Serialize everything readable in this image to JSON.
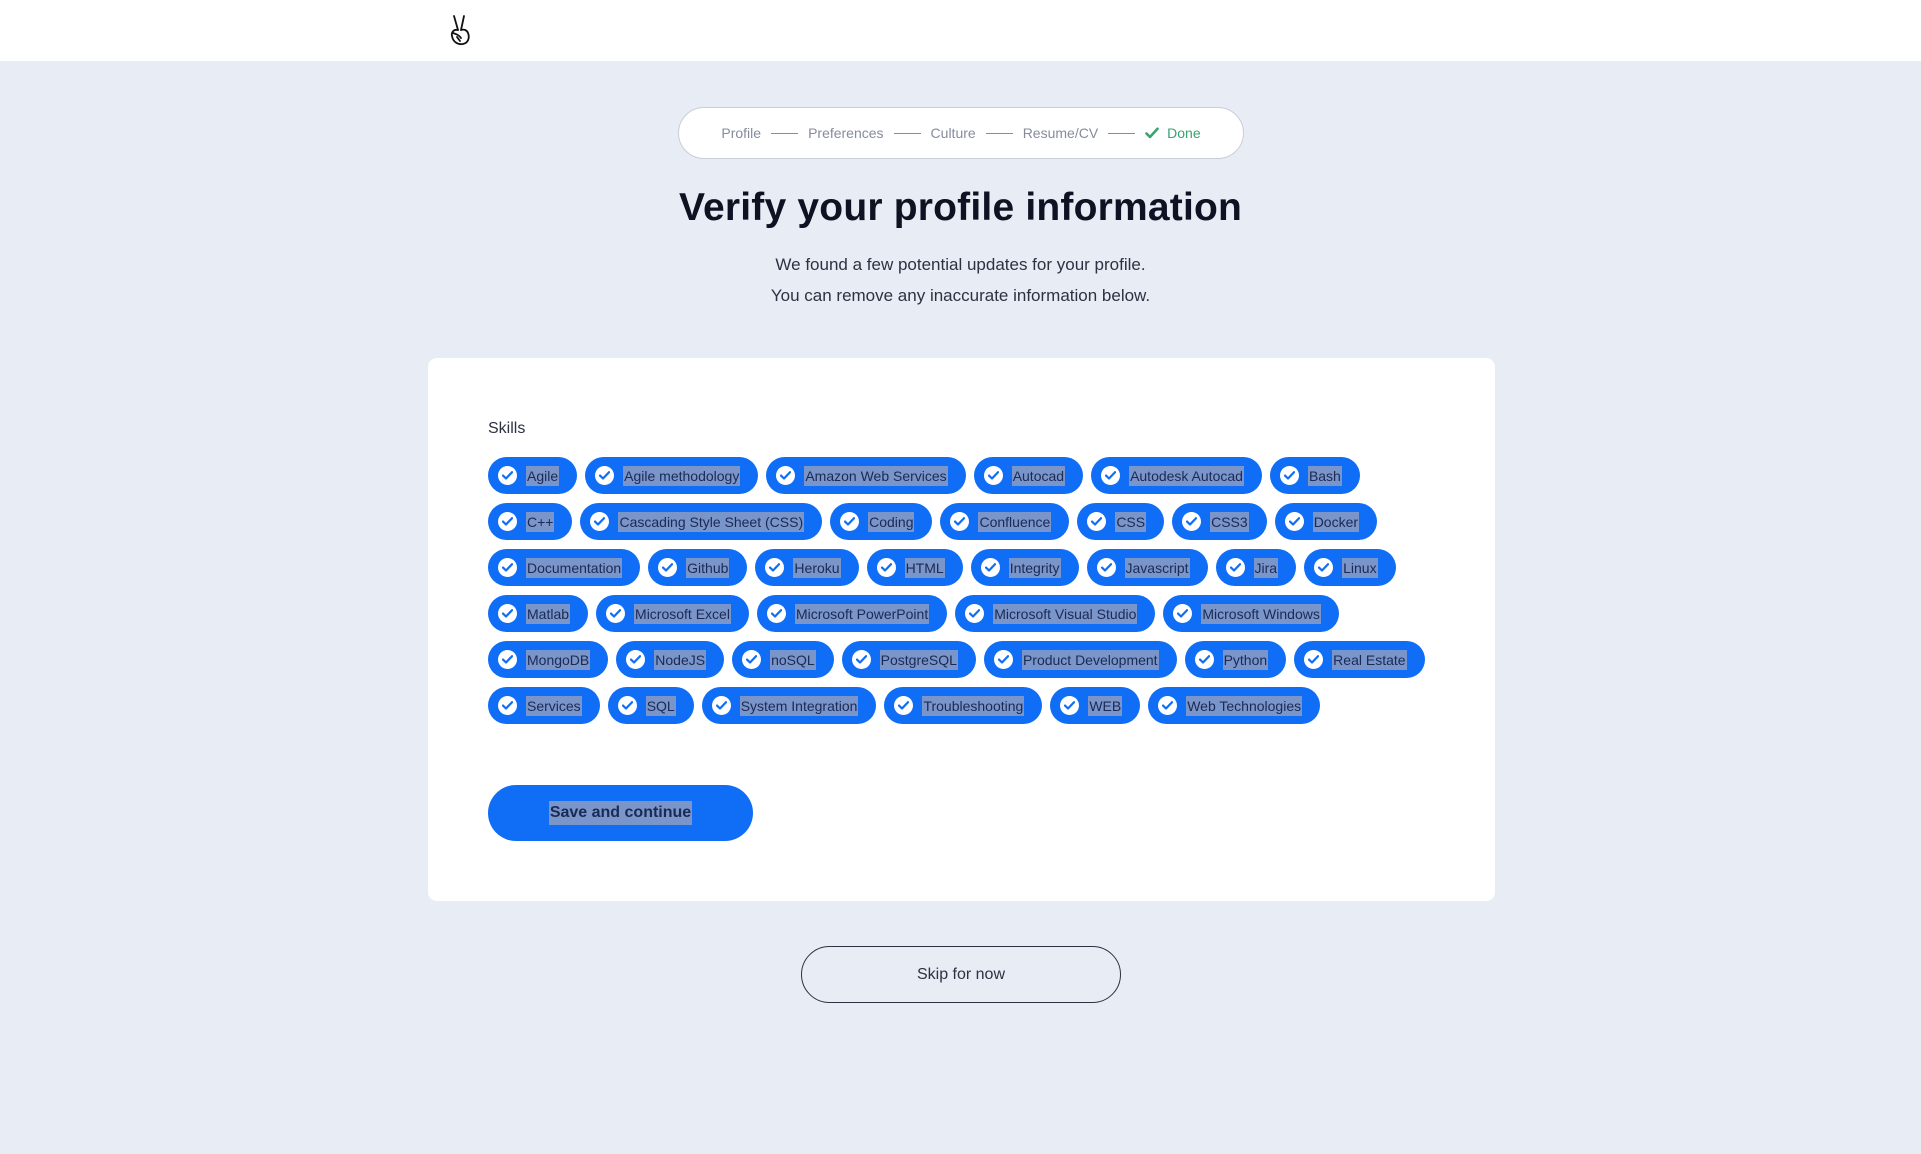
{
  "header": {
    "logo_icon": "peace-hand-icon"
  },
  "stepper": {
    "steps": [
      {
        "label": "Profile"
      },
      {
        "label": "Preferences"
      },
      {
        "label": "Culture"
      },
      {
        "label": "Resume/CV"
      },
      {
        "label": "Done",
        "status": "done",
        "icon": "check-icon"
      }
    ]
  },
  "page": {
    "title": "Verify your profile information",
    "subtitle_line1": "We found a few potential updates for your profile.",
    "subtitle_line2": "You can remove any inaccurate information below."
  },
  "skills": {
    "label": "Skills",
    "items": [
      "Agile",
      "Agile methodology",
      "Amazon Web Services",
      "Autocad",
      "Autodesk Autocad",
      "Bash",
      "C++",
      "Cascading Style Sheet (CSS)",
      "Coding",
      "Confluence",
      "CSS",
      "CSS3",
      "Docker",
      "Documentation",
      "Github",
      "Heroku",
      "HTML",
      "Integrity",
      "Javascript",
      "Jira",
      "Linux",
      "Matlab",
      "Microsoft Excel",
      "Microsoft PowerPoint",
      "Microsoft Visual Studio",
      "Microsoft Windows",
      "MongoDB",
      "NodeJS",
      "noSQL",
      "PostgreSQL",
      "Product Development",
      "Python",
      "Real Estate",
      "Services",
      "SQL",
      "System Integration",
      "Troubleshooting",
      "WEB",
      "Web Technologies"
    ]
  },
  "actions": {
    "save_label": "Save and continue",
    "skip_label": "Skip for now"
  },
  "colors": {
    "accent": "#0f6ef5",
    "page_bg": "#e8ecf4",
    "done_green": "#3aa272",
    "heading": "#0f1222"
  }
}
